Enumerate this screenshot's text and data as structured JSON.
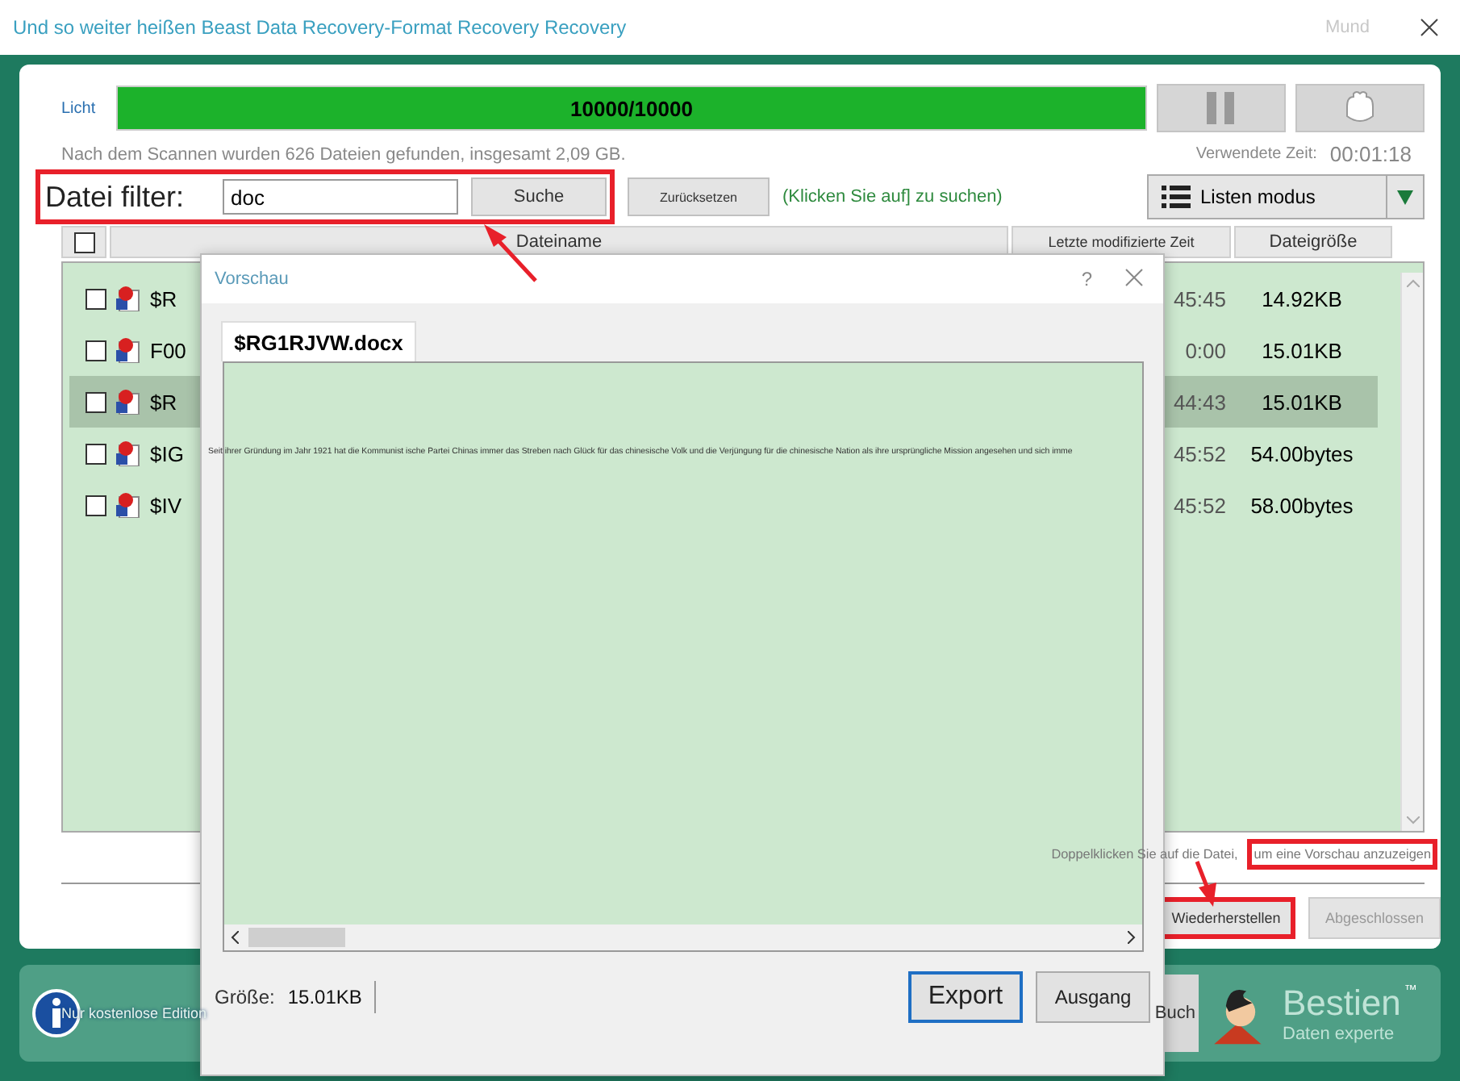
{
  "window": {
    "title": "Und so weiter heißen Beast Data Recovery-Format Recovery Recovery",
    "menu": "Mund"
  },
  "scan": {
    "label": "Licht",
    "progress_text": "10000/10000",
    "level": 1,
    "summary": "Nach dem Scannen wurden 626 Dateien gefunden, insgesamt 2,09 GB.",
    "elapsed_label": "Verwendete Zeit:",
    "elapsed": "00:01:18"
  },
  "filter": {
    "label": "Datei filter:",
    "value": "doc",
    "search_button": "Suche",
    "reset_button": "Zurücksetzen",
    "hint": "(Klicken Sie auf] zu suchen)",
    "highlighted": true
  },
  "view_mode": {
    "label": "Listen modus"
  },
  "table": {
    "columns": [
      "Dateiname",
      "Letzte modifizierte Zeit",
      "Dateigröße"
    ],
    "all_checked": false,
    "rows": [
      {
        "name": "$R",
        "time": "45:45",
        "size": "14.92KB",
        "checked": false,
        "selected": false
      },
      {
        "name": "F00",
        "time": "0:00",
        "size": "15.01KB",
        "checked": false,
        "selected": false
      },
      {
        "name": "$R",
        "time": "44:43",
        "size": "15.01KB",
        "checked": false,
        "selected": true
      },
      {
        "name": "$IG",
        "time": "45:52",
        "size": "54.00bytes",
        "checked": false,
        "selected": false
      },
      {
        "name": "$IV",
        "time": "45:52",
        "size": "58.00bytes",
        "checked": false,
        "selected": false
      }
    ]
  },
  "hint": [
    {
      "text": "Doppelklicken Sie auf die Datei,",
      "highlighted": false
    },
    {
      "text": "um eine Vorschau anzuzeigen",
      "highlighted": true
    }
  ],
  "buttons": [
    {
      "label": "Wiederherstellen",
      "highlighted": true,
      "disabled": false
    },
    {
      "label": "Abgeschlossen",
      "highlighted": false,
      "disabled": true
    }
  ],
  "footer": {
    "edition": "Nur kostenlose Edition",
    "book_button": "Buch",
    "brand": "Bestien",
    "trademark": "™",
    "tagline": "Daten experte"
  },
  "dialog": {
    "title": "Vorschau",
    "help": "?",
    "tab": "$RG1RJVW.docx",
    "preview_text": "Seit ihrer Gründung im Jahr 1921 hat die Kommunist ische Partei Chinas immer das Streben nach Glück für das chinesische Volk und die Verjüngung für die chinesische Nation als ihre ursprüngliche Mission angesehen und sich imme",
    "size_label": "Größe:",
    "size": "15.01KB",
    "buttons": [
      {
        "label": "Export",
        "kind": "primary"
      },
      {
        "label": "Ausgang",
        "kind": "normal"
      }
    ]
  }
}
